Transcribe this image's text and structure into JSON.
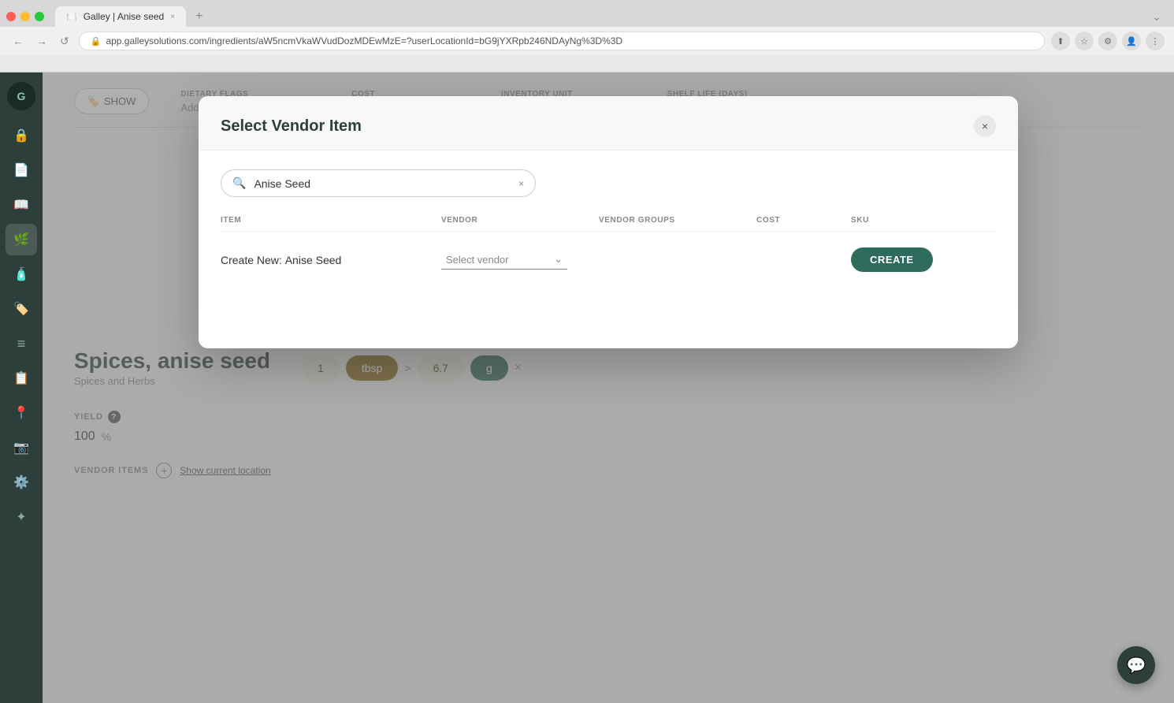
{
  "browser": {
    "traffic_lights": [
      "red",
      "yellow",
      "green"
    ],
    "tab_title": "Galley | Anise seed",
    "tab_close": "×",
    "tab_new": "+",
    "nav_back": "←",
    "nav_forward": "→",
    "nav_reload": "↺",
    "url": "app.galleysolutions.com/ingredients/aW5ncmVkaWVudDozMDEwMzE=?userLocationId=bG9jYXRpb246NDAyNg%3D%3D",
    "browser_chevron": "⌄"
  },
  "sidebar": {
    "logo": "G",
    "items": [
      {
        "id": "lock",
        "icon": "🔒",
        "active": false
      },
      {
        "id": "pages",
        "icon": "📄",
        "active": false
      },
      {
        "id": "book",
        "icon": "📖",
        "active": false
      },
      {
        "id": "ingredients",
        "icon": "🌿",
        "active": true
      },
      {
        "id": "bottles",
        "icon": "🧴",
        "active": false
      },
      {
        "id": "tags",
        "icon": "🏷️",
        "active": false
      },
      {
        "id": "list",
        "icon": "≡",
        "active": false
      },
      {
        "id": "recipes",
        "icon": "📋",
        "active": false
      },
      {
        "id": "location",
        "icon": "📍",
        "active": false
      },
      {
        "id": "camera",
        "icon": "📷",
        "active": false
      },
      {
        "id": "chart",
        "icon": "⚙️",
        "active": false
      },
      {
        "id": "settings2",
        "icon": "✦",
        "active": false
      }
    ]
  },
  "page": {
    "show_button": "SHOW",
    "columns": {
      "dietary_flags": "DIETARY FLAGS",
      "dietary_add": "Add Dietary Flag",
      "cost": "COST",
      "inventory_unit": "INVENTORY UNIT",
      "shelf_life": "SHELF LIFE (DAYS)"
    },
    "ingredient_name": "Spices, anise seed",
    "ingredient_category": "Spices and Herbs",
    "conversion": {
      "quantity1": "1",
      "unit1": "tbsp",
      "arrow": ">",
      "quantity2": "6.7",
      "unit2": "g"
    },
    "yield": {
      "label": "YIELD",
      "value": "100",
      "unit": "%"
    },
    "vendor_items": {
      "label": "VENDOR ITEMS",
      "add_icon": "+",
      "show_location": "Show current location"
    }
  },
  "modal": {
    "title": "Select Vendor Item",
    "close_icon": "×",
    "search": {
      "placeholder": "Anise Seed",
      "value": "Anise Seed",
      "clear_icon": "×"
    },
    "table": {
      "columns": [
        "ITEM",
        "VENDOR",
        "VENDOR GROUPS",
        "COST",
        "SKU"
      ],
      "create_new": {
        "prefix": "Create New:",
        "name": "Anise Seed",
        "vendor_placeholder": "Select vendor",
        "vendor_chevron": "⌄",
        "create_btn": "CREATE"
      }
    }
  },
  "chat": {
    "icon": "💬"
  }
}
